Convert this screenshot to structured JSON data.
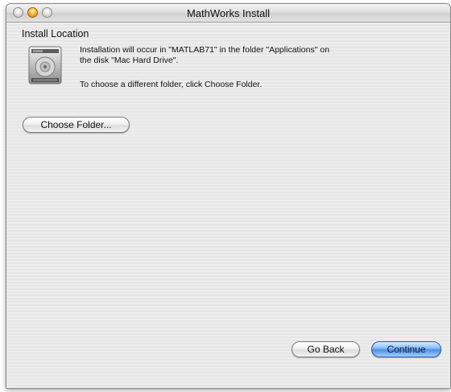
{
  "window": {
    "title": "MathWorks Install"
  },
  "install": {
    "heading": "Install Location",
    "message_line1": "Installation will occur in \"MATLAB71\" in the folder \"Applications\" on",
    "message_line2": "the disk \"Mac Hard Drive\".",
    "message_choose": "To choose a different folder, click Choose Folder."
  },
  "buttons": {
    "choose_folder": "Choose Folder...",
    "go_back": "Go Back",
    "continue": "Continue"
  },
  "colors": {
    "accent_button": "#5a9af0",
    "minimize_button": "#f6b93b"
  },
  "icons": {
    "drive": "hard-drive-icon"
  }
}
